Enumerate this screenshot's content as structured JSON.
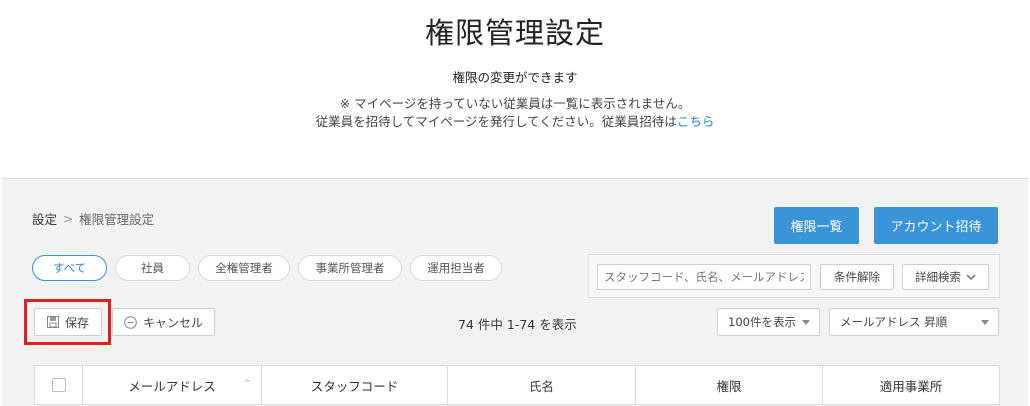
{
  "header": {
    "title": "権限管理設定",
    "subtitle": "権限の変更ができます",
    "note_line1": "※ マイページを持っていない従業員は一覧に表示されません。",
    "note_line2": "従業員を招待してマイページを発行してください。従業員招待は",
    "note_link": "こちら"
  },
  "breadcrumb": {
    "root": "設定",
    "separator": ">",
    "current": "権限管理設定"
  },
  "actions": {
    "permission_list": "権限一覧",
    "invite_account": "アカウント招待"
  },
  "filters": [
    {
      "label": "すべて",
      "active": true
    },
    {
      "label": "社員",
      "active": false
    },
    {
      "label": "全権管理者",
      "active": false
    },
    {
      "label": "事業所管理者",
      "active": false
    },
    {
      "label": "運用担当者",
      "active": false
    }
  ],
  "search": {
    "placeholder": "スタッフコード、氏名、メールアドレス",
    "clear_label": "条件解除",
    "advanced_label": "詳細検索"
  },
  "toolbar": {
    "save_label": "保存",
    "cancel_label": "キャンセル",
    "count_text": "74 件中 1-74 を表示",
    "per_page": "100件を表示",
    "sort": "メールアドレス 昇順"
  },
  "table": {
    "columns": [
      "メールアドレス",
      "スタッフコード",
      "氏名",
      "権限",
      "適用事業所"
    ]
  },
  "colors": {
    "accent": "#3a95d8",
    "highlight": "#e0201c"
  }
}
